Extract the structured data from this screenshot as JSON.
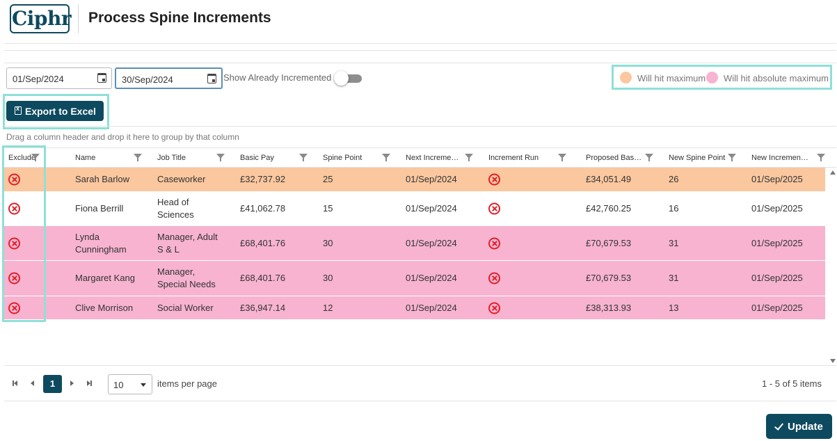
{
  "app": {
    "logo_text": "Ciphr",
    "title": "Process Spine Increments"
  },
  "filters": {
    "from_date": "01/Sep/2024",
    "to_date": "30/Sep/2024",
    "show_incremented_label": "Show Already Incremented",
    "show_incremented_on": false
  },
  "legend": {
    "items": [
      {
        "label": "Will hit maximum",
        "color": "#fbc79f"
      },
      {
        "label": "Will hit absolute maximum",
        "color": "#f7b3d0"
      }
    ]
  },
  "toolbar": {
    "export_label": "Export to Excel"
  },
  "grid": {
    "group_hint": "Drag a column header and drop it here to group by that column",
    "columns": [
      "Exclude",
      "Name",
      "Job Title",
      "Basic Pay",
      "Spine Point",
      "Next Increment Date",
      "Increment Run",
      "Proposed Basic Pay",
      "New Spine Point",
      "New Increment Date"
    ],
    "rows": [
      {
        "name": "Sarah Barlow",
        "job_title": "Caseworker",
        "basic_pay": "£32,737.92",
        "spine_point": "25",
        "next_increment": "01/Sep/2024",
        "proposed_basic": "£34,051.49",
        "new_spine_point": "26",
        "new_increment": "01/Sep/2025",
        "highlight": "max"
      },
      {
        "name": "Fiona Berrill",
        "job_title": "Head of Sciences",
        "basic_pay": "£41,062.78",
        "spine_point": "15",
        "next_increment": "01/Sep/2024",
        "proposed_basic": "£42,760.25",
        "new_spine_point": "16",
        "new_increment": "01/Sep/2025",
        "highlight": "none"
      },
      {
        "name": "Lynda Cunningham",
        "job_title": "Manager, Adult S & L",
        "basic_pay": "£68,401.76",
        "spine_point": "30",
        "next_increment": "01/Sep/2024",
        "proposed_basic": "£70,679.53",
        "new_spine_point": "31",
        "new_increment": "01/Sep/2025",
        "highlight": "absolute"
      },
      {
        "name": "Margaret Kang",
        "job_title": "Manager, Special Needs",
        "basic_pay": "£68,401.76",
        "spine_point": "30",
        "next_increment": "01/Sep/2024",
        "proposed_basic": "£70,679.53",
        "new_spine_point": "31",
        "new_increment": "01/Sep/2025",
        "highlight": "absolute"
      },
      {
        "name": "Clive Morrison",
        "job_title": "Social Worker",
        "basic_pay": "£36,947.14",
        "spine_point": "12",
        "next_increment": "01/Sep/2024",
        "proposed_basic": "£38,313.93",
        "new_spine_point": "13",
        "new_increment": "01/Sep/2025",
        "highlight": "absolute"
      }
    ]
  },
  "pager": {
    "current_page": "1",
    "page_size": "10",
    "items_per_page_label": "items per page",
    "info": "1 - 5 of 5 items"
  },
  "footer": {
    "update_label": "Update"
  },
  "colors": {
    "brand": "#0e4a5f",
    "max_row": "#fbc79f",
    "absolute_row": "#f7b3d0",
    "exclude_icon": "#e0202a",
    "highlight_box": "#8ee0d8"
  }
}
